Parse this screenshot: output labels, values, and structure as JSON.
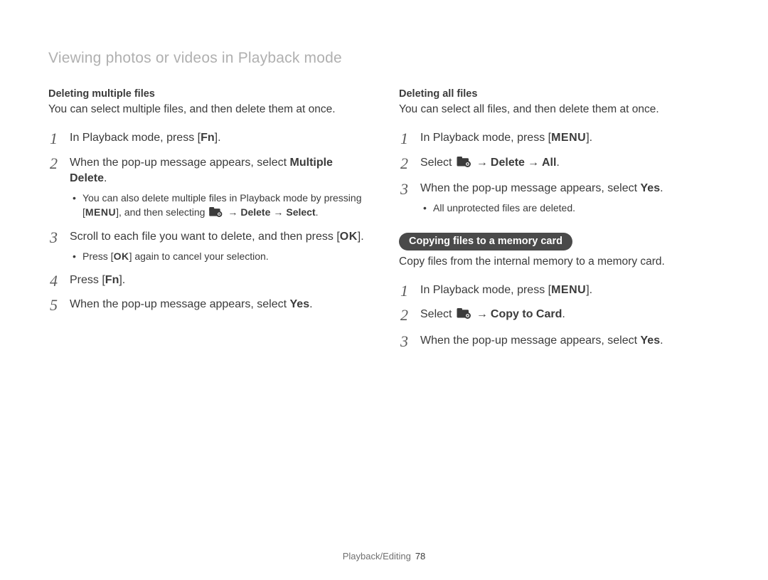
{
  "header": {
    "title": "Viewing photos or videos in Playback mode"
  },
  "left": {
    "heading": "Deleting multiple files",
    "intro": "You can select multiple files, and then delete them at once.",
    "steps": {
      "s1_a": "In Playback mode, press [",
      "s1_key": "Fn",
      "s1_b": "].",
      "s2_a": "When the pop-up message appears, select ",
      "s2_bold": "Multiple Delete",
      "s2_b": ".",
      "s2_sub_a": "You can also delete multiple files in Playback mode by pressing [",
      "s2_sub_menu": "MENU",
      "s2_sub_b": "], and then selecting ",
      "s2_sub_arrow1": "→",
      "s2_sub_delete": "Delete",
      "s2_sub_arrow2": "→",
      "s2_sub_select": "Select",
      "s2_sub_end": ".",
      "s3_a": "Scroll to each file you want to delete, and then press [",
      "s3_key": "OK",
      "s3_b": "].",
      "s3_sub_a": "Press [",
      "s3_sub_key": "OK",
      "s3_sub_b": "] again to cancel your selection.",
      "s4_a": "Press [",
      "s4_key": "Fn",
      "s4_b": "].",
      "s5_a": "When the pop-up message appears, select ",
      "s5_yes": "Yes",
      "s5_b": "."
    }
  },
  "right": {
    "heading": "Deleting all files",
    "intro": "You can select all files, and then delete them at once.",
    "steps": {
      "s1_a": "In Playback mode, press [",
      "s1_key": "MENU",
      "s1_b": "].",
      "s2_a": "Select ",
      "s2_arrow1": "→",
      "s2_delete": "Delete",
      "s2_arrow2": "→",
      "s2_all": "All",
      "s2_b": ".",
      "s3_a": "When the pop-up message appears, select ",
      "s3_yes": "Yes",
      "s3_b": ".",
      "s3_sub": "All unprotected files are deleted."
    },
    "pill": "Copying files to a memory card",
    "pill_intro": "Copy files from the internal memory to a memory card.",
    "copy_steps": {
      "s1_a": "In Playback mode, press [",
      "s1_key": "MENU",
      "s1_b": "].",
      "s2_a": "Select ",
      "s2_arrow": "→",
      "s2_copy": "Copy to Card",
      "s2_b": ".",
      "s3_a": "When the pop-up message appears, select ",
      "s3_yes": "Yes",
      "s3_b": "."
    }
  },
  "footer": {
    "section": "Playback/Editing",
    "page": "78"
  }
}
